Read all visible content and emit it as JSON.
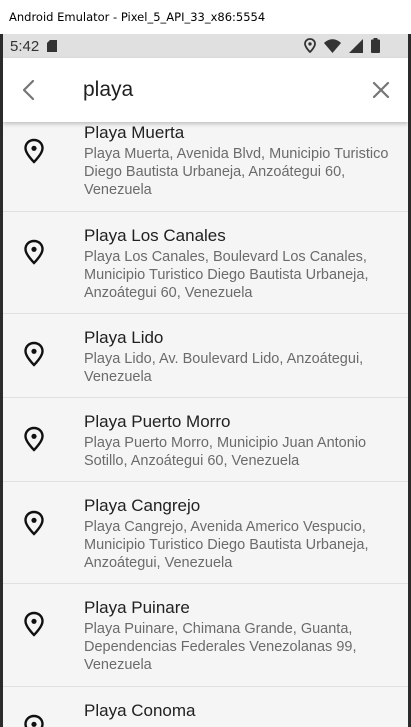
{
  "window": {
    "title": "Android Emulator - Pixel_5_API_33_x86:5554"
  },
  "status_bar": {
    "time": "5:42",
    "icons": [
      "sim-icon",
      "location-icon",
      "wifi-icon",
      "signal-icon",
      "battery-icon"
    ]
  },
  "app_bar": {
    "back_icon": "arrow-back-icon",
    "search_value": "playa",
    "clear_icon": "close-icon"
  },
  "colors": {
    "background": "#f5f5f5",
    "app_bar": "#ffffff",
    "status_bar": "#e0e0e0",
    "title": "#212121",
    "subtitle": "#6b6b6b"
  },
  "results": [
    {
      "title": "Playa Muerta",
      "address": "Playa Muerta, Avenida Blvd, Municipio Turistico Diego Bautista Urbaneja, Anzoátegui 60, Venezuela",
      "icon": "location-pin-icon"
    },
    {
      "title": "Playa Los Canales",
      "address": "Playa Los Canales, Boulevard Los Canales, Municipio Turistico Diego Bautista Urbaneja, Anzoátegui 60, Venezuela",
      "icon": "location-pin-icon"
    },
    {
      "title": "Playa Lido",
      "address": "Playa Lido, Av. Boulevard Lido, Anzoátegui, Venezuela",
      "icon": "location-pin-icon"
    },
    {
      "title": "Playa Puerto Morro",
      "address": "Playa Puerto Morro, Municipio Juan Antonio Sotillo, Anzoátegui 60, Venezuela",
      "icon": "location-pin-icon"
    },
    {
      "title": "Playa Cangrejo",
      "address": "Playa Cangrejo, Avenida Americo Vespucio, Municipio Turistico Diego Bautista Urbaneja, Anzoátegui, Venezuela",
      "icon": "location-pin-icon"
    },
    {
      "title": "Playa Puinare",
      "address": "Playa Puinare, Chimana Grande, Guanta, Dependencias Federales Venezolanas 99, Venezuela",
      "icon": "location-pin-icon"
    },
    {
      "title": "Playa Conoma",
      "address": "",
      "icon": "location-pin-icon"
    }
  ]
}
